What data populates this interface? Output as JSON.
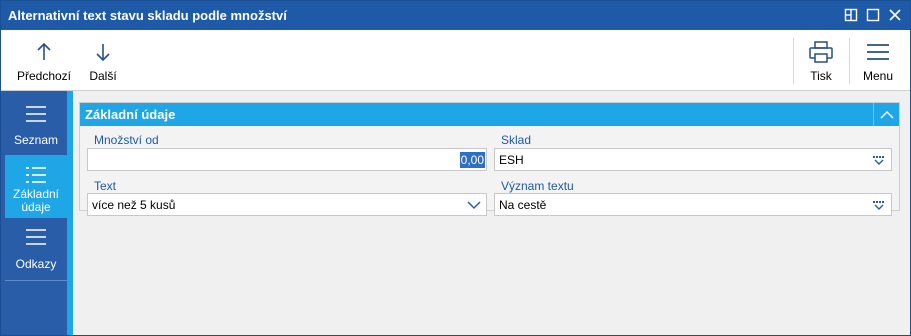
{
  "window": {
    "title": "Alternativní text stavu skladu podle množství"
  },
  "toolbar": {
    "prev_label": "Předchozí",
    "next_label": "Další",
    "print_label": "Tisk",
    "menu_label": "Menu"
  },
  "sidebar": {
    "items": [
      {
        "label": "Seznam",
        "icon": "list-icon"
      },
      {
        "label_line1": "Základní",
        "label_line2": "údaje",
        "icon": "list-detail-icon",
        "active": true
      },
      {
        "label": "Odkazy",
        "icon": "list-icon"
      }
    ]
  },
  "section": {
    "title": "Základní údaje",
    "collapse_icon": "chevron-up-icon"
  },
  "form": {
    "quantity_from": {
      "label": "Množství od",
      "value": "0,00"
    },
    "warehouse": {
      "label": "Sklad",
      "value": "ESH"
    },
    "text": {
      "label": "Text",
      "value": "více než 5 kusů"
    },
    "text_meaning": {
      "label": "Význam textu",
      "value": "Na cestě"
    }
  },
  "colors": {
    "titlebar": "#1e5aa8",
    "sidebar": "#2a5da8",
    "accent": "#1ea6e6",
    "label_text": "#1e5aa8"
  }
}
